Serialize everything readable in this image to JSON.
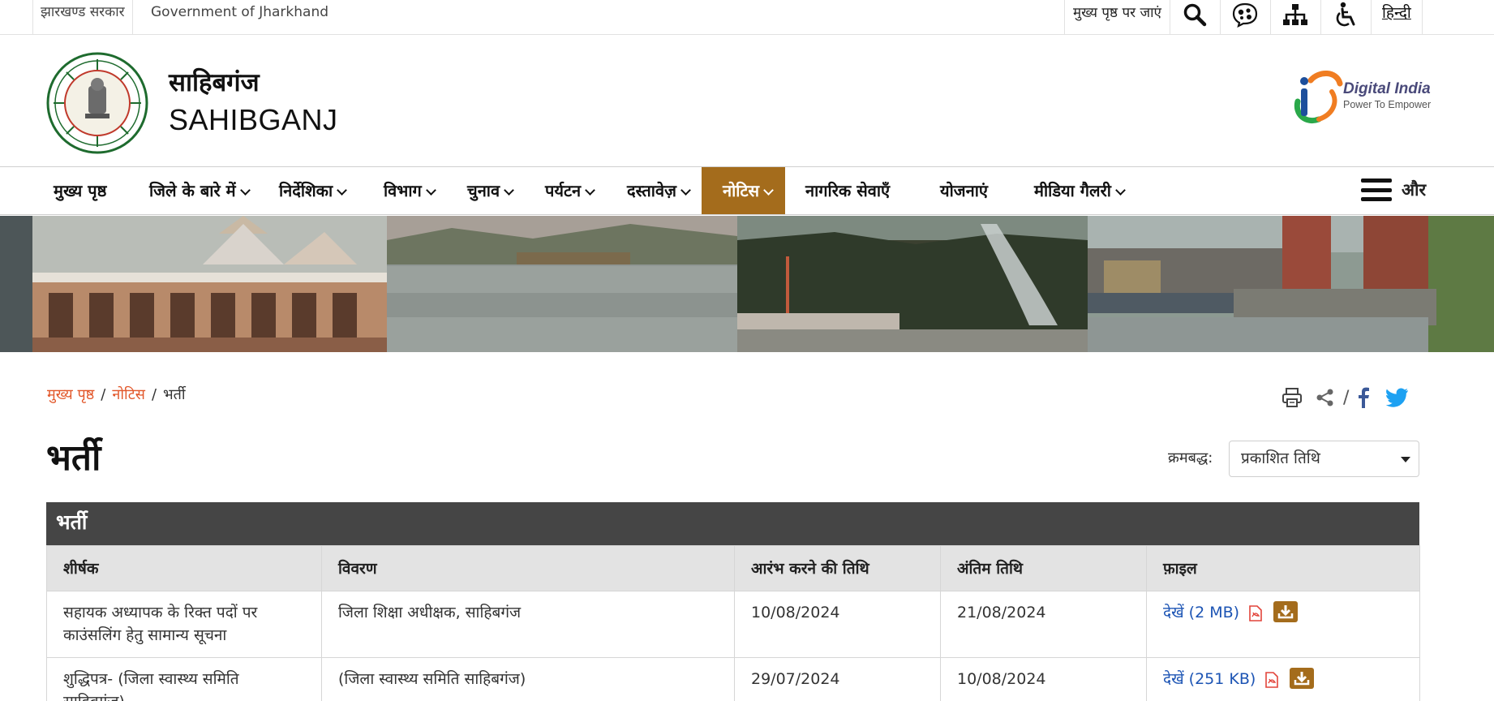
{
  "topbar": {
    "gov_hindi": "झारखण्ड सरकार",
    "gov_english": "Government of Jharkhand",
    "skip_to_main": "मुख्य पृष्ठ पर जाएं",
    "language_toggle": "हिन्दी",
    "icons": [
      "search-icon",
      "screen-reader-icon",
      "sitemap-icon",
      "accessibility-icon"
    ]
  },
  "header": {
    "site_name_hindi": "साहिबगंज",
    "site_name_english": "SAHIBGANJ",
    "emblem_text": "झारखण्ड सरकार · GOVERNMENT OF JHARKHAND",
    "partner_logo_title": "Digital India",
    "partner_logo_tagline": "Power To Empower"
  },
  "nav": {
    "items": [
      {
        "label": "मुख्य पृष्ठ",
        "dropdown": false
      },
      {
        "label": "जिले के बारे में",
        "dropdown": true
      },
      {
        "label": "निर्देशिका",
        "dropdown": true
      },
      {
        "label": "विभाग",
        "dropdown": true
      },
      {
        "label": "चुनाव",
        "dropdown": true
      },
      {
        "label": "पर्यटन",
        "dropdown": true
      },
      {
        "label": "दस्तावेज़",
        "dropdown": true
      },
      {
        "label": "नोटिस",
        "dropdown": true,
        "active": true
      },
      {
        "label": "नागरिक सेवाएँ",
        "dropdown": false
      },
      {
        "label": "योजनाएं",
        "dropdown": false
      },
      {
        "label": "मीडिया गैलरी",
        "dropdown": true
      }
    ],
    "more_label": "और",
    "active_color": "#a46c1c"
  },
  "breadcrumb": {
    "items": [
      "मुख्य पृष्ठ",
      "नोटिस",
      "भर्ती"
    ],
    "link_color": "#e2572a"
  },
  "share": {
    "icons": [
      "print-icon",
      "share-icon",
      "facebook-icon",
      "twitter-icon"
    ],
    "separator": "/"
  },
  "page": {
    "title": "भर्ती",
    "sort_label": "क्रमबद्ध:",
    "sort_value": "प्रकाशित तिथि"
  },
  "table": {
    "caption": "भर्ती",
    "headers": [
      "शीर्षक",
      "विवरण",
      "आरंभ करने की तिथि",
      "अंतिम तिथि",
      "फ़ाइल"
    ],
    "rows": [
      {
        "title": "सहायक अध्यापक के रिक्त पदों पर काउंसलिंग हेतु सामान्य सूचना",
        "description": "जिला शिक्षा अधीक्षक, साहिबगंज",
        "start_date": "10/08/2024",
        "end_date": "21/08/2024",
        "file": "देखें (2 MB)"
      },
      {
        "title": "शुद्धिपत्र- (जिला स्वास्थ्य समिति साहिबगंज)",
        "description": "(जिला स्वास्थ्य समिति साहिबगंज)",
        "start_date": "29/07/2024",
        "end_date": "10/08/2024",
        "file": "देखें (251 KB)"
      }
    ]
  }
}
